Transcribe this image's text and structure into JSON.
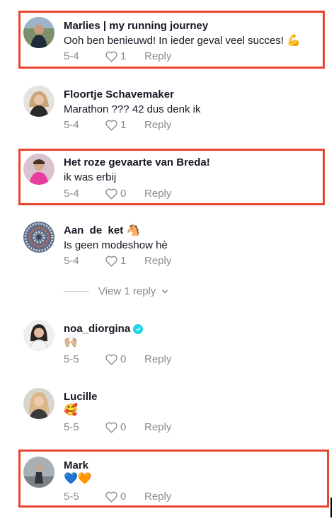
{
  "comments": [
    {
      "username": "Marlies | my running journey",
      "text": "Ooh ben benieuwd! In ieder geval veel succes!",
      "emoji": "💪",
      "date": "5-4",
      "likes": "1",
      "reply": "Reply",
      "highlighted": true
    },
    {
      "username": "Floortje Schavemaker",
      "text": "Marathon ??? 42 dus denk ik",
      "date": "5-4",
      "likes": "1",
      "reply": "Reply",
      "highlighted": false
    },
    {
      "username": "Het roze gevaarte van Breda!",
      "text": "ik was erbij",
      "date": "5-4",
      "likes": "0",
      "reply": "Reply",
      "highlighted": true
    },
    {
      "username": "Aan  de  ket",
      "username_emoji": "🐴",
      "text": "Is geen modeshow hè",
      "date": "5-4",
      "likes": "1",
      "reply": "Reply",
      "highlighted": false,
      "view_replies": "View 1 reply"
    },
    {
      "username": "noa_diorgina",
      "verified": true,
      "text": "🙌🏼",
      "date": "5-5",
      "likes": "0",
      "reply": "Reply",
      "highlighted": false
    },
    {
      "username": "Lucille",
      "text": "🥰",
      "date": "5-5",
      "likes": "0",
      "reply": "Reply",
      "highlighted": false
    },
    {
      "username": "Mark",
      "text": "💙🧡",
      "date": "5-5",
      "likes": "0",
      "reply": "Reply",
      "highlighted": true
    }
  ],
  "colors": {
    "highlight": "#e8452e",
    "secondary_text": "#8a8b91",
    "primary_text": "#161823",
    "verified": "#20d5ec"
  }
}
